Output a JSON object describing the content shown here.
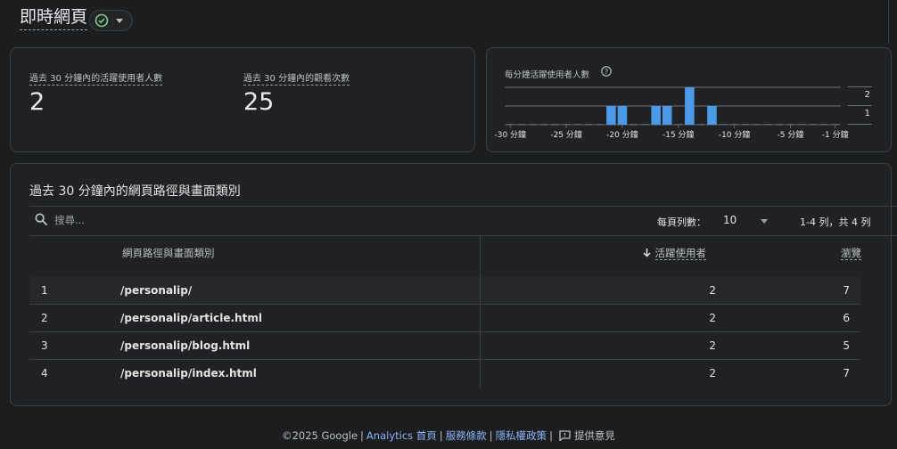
{
  "header": {
    "title": "即時網頁",
    "status_icon": "check-circle-icon",
    "status_color": "#81c995"
  },
  "metrics": [
    {
      "label": "過去 30 分鐘內的活躍使用者人數",
      "value": "2"
    },
    {
      "label": "過去 30 分鐘內的觀看次數",
      "value": "25"
    }
  ],
  "chart_card": {
    "title": "每分鐘活躍使用者人數"
  },
  "chart_data": {
    "type": "bar",
    "title": "每分鐘活躍使用者人數",
    "bar_color": "#4a9ae8",
    "x": [
      -30,
      -29,
      -28,
      -27,
      -26,
      -25,
      -24,
      -23,
      -22,
      -21,
      -20,
      -19,
      -18,
      -17,
      -16,
      -15,
      -14,
      -13,
      -12,
      -11,
      -10,
      -9,
      -8,
      -7,
      -6,
      -5,
      -4,
      -3,
      -2,
      -1
    ],
    "values": [
      0,
      0,
      0,
      0,
      0,
      0,
      0,
      0,
      0,
      1,
      1,
      0,
      0,
      1,
      1,
      0,
      2,
      0,
      1,
      0,
      0,
      0,
      0,
      0,
      0,
      0,
      0,
      0,
      0,
      0
    ],
    "x_tick_labels": [
      "-30 分鐘",
      "-25 分鐘",
      "-20 分鐘",
      "-15 分鐘",
      "-10 分鐘",
      "-5 分鐘",
      "-1 分鐘"
    ],
    "x_tick_values": [
      -30,
      -25,
      -20,
      -15,
      -10,
      -5,
      -1
    ],
    "y_tick_labels": [
      "2",
      "1"
    ],
    "ylim": [
      0,
      2
    ],
    "grid": true
  },
  "table": {
    "title": "過去 30 分鐘內的網頁路徑與畫面類別",
    "search_placeholder": "搜尋...",
    "rows_per_page_label": "每頁列數：",
    "rows_per_page_value": "10",
    "page_info": "1-4 列，共 4 列",
    "columns": {
      "dimension": "網頁路徑與畫面類別",
      "users": "活躍使用者",
      "views": "瀏覽"
    },
    "rows": [
      {
        "index": "1",
        "path": "/personalip/",
        "users": "2",
        "views": "7"
      },
      {
        "index": "2",
        "path": "/personalip/article.html",
        "users": "2",
        "views": "6"
      },
      {
        "index": "3",
        "path": "/personalip/blog.html",
        "users": "2",
        "views": "5"
      },
      {
        "index": "4",
        "path": "/personalip/index.html",
        "users": "2",
        "views": "7"
      }
    ]
  },
  "footer": {
    "copyright": "©2025 Google",
    "analytics_home": "Analytics 首頁",
    "terms": "服務條款",
    "privacy": "隱私權政策",
    "feedback": "提供意見"
  }
}
